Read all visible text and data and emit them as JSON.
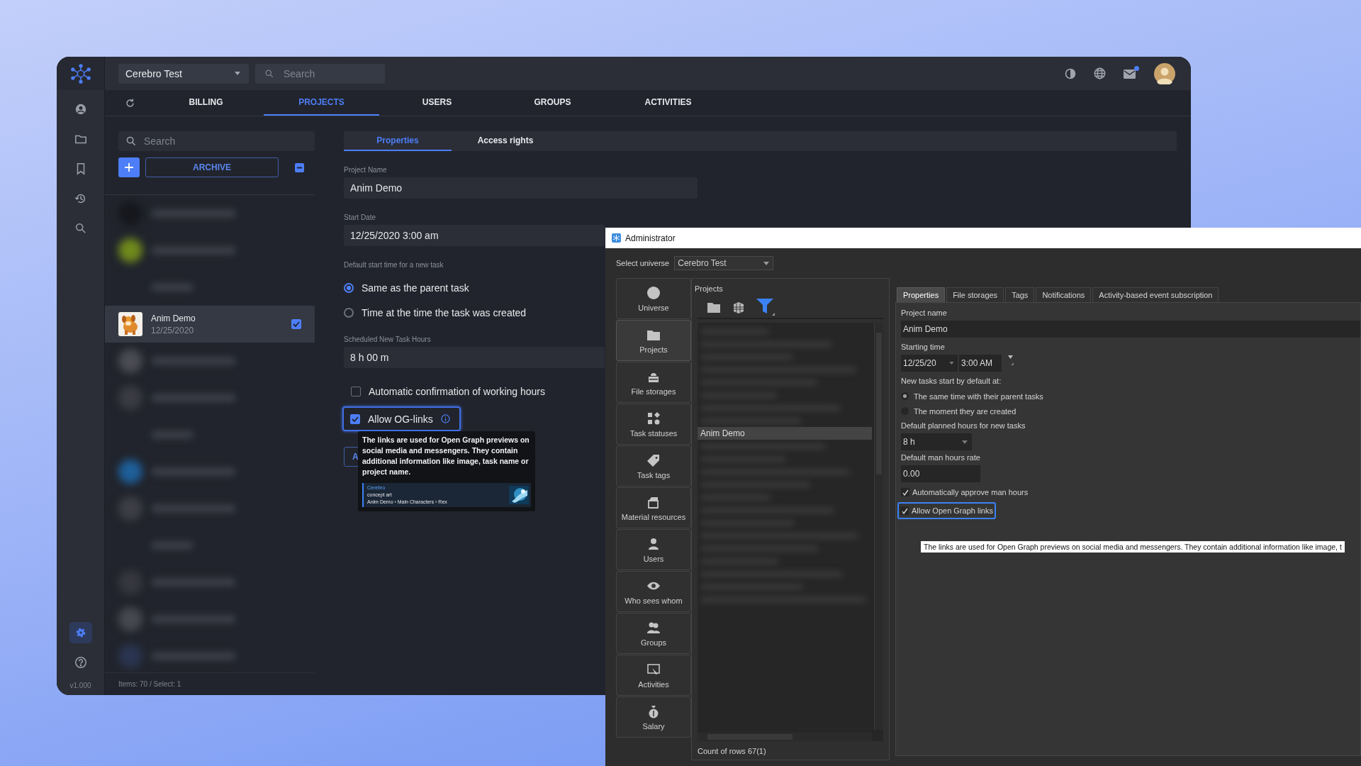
{
  "web_app": {
    "sidebar": {
      "items": [
        {
          "kind": "user",
          "selected": false
        },
        {
          "kind": "folder",
          "selected": false
        },
        {
          "kind": "bookmark",
          "selected": false
        },
        {
          "kind": "history",
          "selected": false
        },
        {
          "kind": "search",
          "selected": false
        }
      ],
      "bottom_items": [
        {
          "kind": "settings",
          "selected": true
        },
        {
          "kind": "help",
          "selected": false
        }
      ],
      "version": "v1.000"
    },
    "header": {
      "universe": "Cerebro Test",
      "search_placeholder": "Search",
      "mail_unread": true
    },
    "tabs": [
      {
        "label": "BILLING",
        "selected": false
      },
      {
        "label": "PROJECTS",
        "selected": true
      },
      {
        "label": "USERS",
        "selected": false
      },
      {
        "label": "GROUPS",
        "selected": false
      },
      {
        "label": "ACTIVITIES",
        "selected": false
      }
    ],
    "project_list": {
      "search_placeholder": "Search",
      "archive_label": "ARCHIVE",
      "items": [
        {
          "kind": "blurred",
          "color": "#15171b"
        },
        {
          "kind": "blurred",
          "color": "#6f8a1c"
        },
        {
          "kind": "blurred_text"
        },
        {
          "kind": "project",
          "name": "Anim Demo",
          "date": "12/25/2020",
          "selected": true,
          "checked": true
        },
        {
          "kind": "blurred",
          "color": "#4a4c52"
        },
        {
          "kind": "blurred",
          "color": "#3a3c42"
        },
        {
          "kind": "blurred_text"
        },
        {
          "kind": "blurred",
          "color": "#1e5f9a"
        },
        {
          "kind": "blurred",
          "color": "#3d3f45"
        },
        {
          "kind": "blurred_text"
        },
        {
          "kind": "blurred",
          "color": "#36383e"
        },
        {
          "kind": "blurred",
          "color": "#474950"
        },
        {
          "kind": "blurred",
          "color": "#2a3550"
        }
      ],
      "status": "Items: 70 / Select: 1"
    },
    "properties": {
      "tabs": [
        {
          "label": "Properties",
          "selected": true
        },
        {
          "label": "Access rights",
          "selected": false
        }
      ],
      "project_name_label": "Project Name",
      "project_name": "Anim Demo",
      "start_date_label": "Start Date",
      "start_date": "12/25/2020 3:00 am",
      "start_time_label": "Default start time for a new task",
      "start_time_options": [
        {
          "label": "Same as the parent task",
          "selected": true
        },
        {
          "label": "Time at the time the task was created",
          "selected": false
        }
      ],
      "hours_label": "Scheduled New Task Hours",
      "hours": "8 h 00 m",
      "auto_confirm": {
        "label": "Automatic confirmation of working hours",
        "checked": false
      },
      "og_links": {
        "label": "Allow OG-links",
        "checked": true
      },
      "hidden_button_label": "A",
      "tooltip": {
        "text": "The links are used for Open Graph previews on social media and messengers. They contain additional information like image, task name or project name.",
        "preview": {
          "site": "Cerebro",
          "title": "concept art",
          "path": "Anim Demo › Main Characters › Rex"
        }
      }
    }
  },
  "admin_window": {
    "title": "Administrator",
    "universe_label": "Select universe",
    "universe": "Cerebro Test",
    "nav": [
      {
        "kind": "universe",
        "label": "Universe",
        "selected": false
      },
      {
        "kind": "projects",
        "label": "Projects",
        "selected": true
      },
      {
        "kind": "storages",
        "label": "File storages",
        "selected": false
      },
      {
        "kind": "statuses",
        "label": "Task statuses",
        "selected": false
      },
      {
        "kind": "tags",
        "label": "Task tags",
        "selected": false
      },
      {
        "kind": "materials",
        "label": "Material resources",
        "selected": false
      },
      {
        "kind": "users",
        "label": "Users",
        "selected": false
      },
      {
        "kind": "visibility",
        "label": "Who sees whom",
        "selected": false
      },
      {
        "kind": "groups",
        "label": "Groups",
        "selected": false
      },
      {
        "kind": "activities",
        "label": "Activities",
        "selected": false
      },
      {
        "kind": "salary",
        "label": "Salary",
        "selected": false
      }
    ],
    "projects": {
      "title": "Projects",
      "rows": [
        {
          "kind": "blurred"
        },
        {
          "kind": "blurred"
        },
        {
          "kind": "blurred"
        },
        {
          "kind": "blurred"
        },
        {
          "kind": "blurred"
        },
        {
          "kind": "blurred"
        },
        {
          "kind": "blurred"
        },
        {
          "kind": "blurred"
        },
        {
          "kind": "project",
          "label": "Anim Demo",
          "selected": true
        },
        {
          "kind": "blurred"
        },
        {
          "kind": "blurred"
        },
        {
          "kind": "blurred"
        },
        {
          "kind": "blurred"
        },
        {
          "kind": "blurred"
        },
        {
          "kind": "blurred"
        },
        {
          "kind": "blurred"
        },
        {
          "kind": "blurred"
        },
        {
          "kind": "blurred"
        },
        {
          "kind": "blurred"
        },
        {
          "kind": "blurred"
        },
        {
          "kind": "blurred"
        },
        {
          "kind": "blurred"
        }
      ],
      "count": "Count of rows 67(1)"
    },
    "tabs": [
      {
        "label": "Properties",
        "selected": true
      },
      {
        "label": "File storages",
        "selected": false
      },
      {
        "label": "Tags",
        "selected": false
      },
      {
        "label": "Notifications",
        "selected": false
      },
      {
        "label": "Activity-based event subscription",
        "selected": false
      }
    ],
    "project_name_label": "Project name",
    "project_name": "Anim Demo",
    "starting_time_label": "Starting time",
    "date": "12/25/20",
    "time": "3:00 AM",
    "new_tasks_label": "New tasks start by default at:",
    "start_options": [
      {
        "label": "The same time with their parent tasks",
        "selected": true
      },
      {
        "label": "The moment they are created",
        "selected": false
      }
    ],
    "planned_hours_label": "Default planned hours for new tasks",
    "planned_hours": "8 h",
    "rate_label": "Default man hours rate",
    "rate": "0.00",
    "auto_approve": {
      "label": "Automatically approve man hours",
      "checked": true
    },
    "og_links": {
      "label": "Allow Open Graph links",
      "checked": true
    },
    "tooltip": "The links are used for Open Graph previews on social media and messengers. They contain additional information like image, t"
  }
}
